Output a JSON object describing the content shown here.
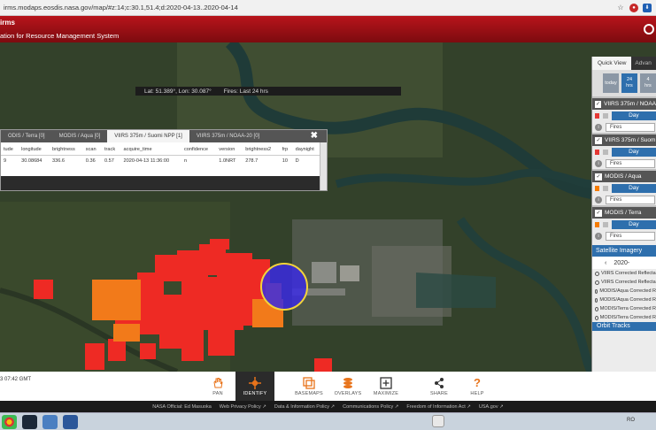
{
  "browser": {
    "url": "irms.modaps.eosdis.nasa.gov/map/#z:14;c:30.1,51.4;d:2020-04-13..2020-04-14"
  },
  "header": {
    "title_short": "irms",
    "title": "ation for Resource Management System"
  },
  "coord_bar": {
    "position": "Lat: 51.389°, Lon: 30.087°",
    "fires": "Fires: Last 24 hrs"
  },
  "identify": {
    "tabs": [
      {
        "label": "ODIS / Terra  [0]",
        "active": false
      },
      {
        "label": "MODIS / Aqua  [0]",
        "active": false
      },
      {
        "label": "VIIRS 375m / Suomi NPP  [1]",
        "active": true
      },
      {
        "label": "VIIRS 375m / NOAA-20  [0]",
        "active": false
      }
    ],
    "close": "✖",
    "columns": [
      "tude",
      "longitude",
      "brightness",
      "scan",
      "track",
      "acquire_time",
      "confidence",
      "version",
      "brightness2",
      "frp",
      "daynight"
    ],
    "row": [
      "9",
      "30.08684",
      "336.6",
      "0.36",
      "0.57",
      "2020-04-13 11:36:00",
      "n",
      "1.0NRT",
      "278.7",
      "10",
      "D"
    ]
  },
  "quick_view": {
    "tab_quick": "Quick View",
    "tab_adv": "Advan",
    "times": [
      {
        "line1": "today",
        "line2": "",
        "active": false
      },
      {
        "line1": "24",
        "line2": "hrs",
        "active": true
      },
      {
        "line1": "4",
        "line2": "hrs",
        "active": false
      }
    ],
    "layers": [
      {
        "name": "VIIRS 375m / NOAA",
        "day": "Day",
        "fires": "Fires",
        "color": "#e53935"
      },
      {
        "name": "VIIRS 375m / Suom",
        "day": "Day",
        "fires": "Fires",
        "color": "#e53935"
      },
      {
        "name": "MODIS / Aqua",
        "day": "Day",
        "fires": "Fires",
        "color": "#f57c00"
      },
      {
        "name": "MODIS / Terra",
        "day": "Day",
        "fires": "Fires",
        "color": "#f57c00"
      }
    ],
    "satellite_title": "Satellite Imagery",
    "sat_date": "2020-",
    "sat_items": [
      "VIIRS Corrected Reflecta",
      "VIIRS Corrected Reflecta",
      "MODIS/Aqua Corrected R",
      "MODIS/Aqua Corrected R",
      "MODIS/Terra Corrected R",
      "MODIS/Terra Corrected R"
    ],
    "orbit_title": "Orbit Tracks"
  },
  "toolbar": {
    "time": "3 07:42 GMT",
    "tools": [
      {
        "label": "PAN",
        "icon": "hand-icon",
        "active": false
      },
      {
        "label": "IDENTIFY",
        "icon": "crosshair-icon",
        "active": true
      },
      {
        "label": "BASEMAPS",
        "icon": "basemaps-icon",
        "active": false
      },
      {
        "label": "OVERLAYS",
        "icon": "overlays-icon",
        "active": false
      },
      {
        "label": "MAXIMIZE",
        "icon": "maximize-icon",
        "active": false
      },
      {
        "label": "SHARE",
        "icon": "share-icon",
        "active": false
      },
      {
        "label": "HELP",
        "icon": "help-icon",
        "active": false
      }
    ]
  },
  "footer": {
    "links": [
      "NASA Official: Ed Masuoka",
      "Web Privacy Policy ↗",
      "Data & Information Policy ↗",
      "Communications Policy ↗",
      "Freedom of Information Act ↗",
      "USA.gov ↗"
    ]
  },
  "taskbar": {
    "lang": "RO"
  },
  "colors": {
    "header_red": "#a3121a",
    "viirs_red": "#e53935",
    "modis_orange": "#f57c00",
    "accent_blue": "#2e6fad"
  }
}
